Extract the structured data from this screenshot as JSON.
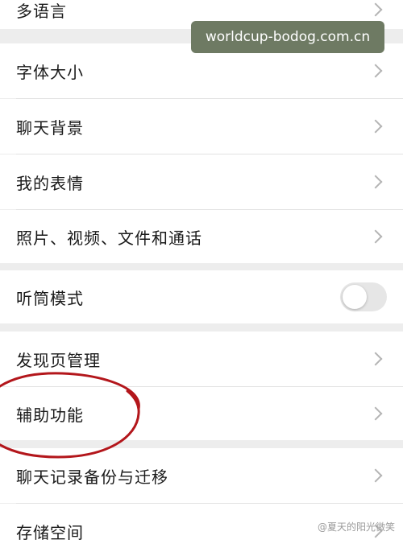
{
  "settings": {
    "rows": [
      {
        "label": "多语言",
        "control": "chevron"
      },
      {
        "label": "字体大小",
        "control": "chevron"
      },
      {
        "label": "聊天背景",
        "control": "chevron"
      },
      {
        "label": "我的表情",
        "control": "chevron"
      },
      {
        "label": "照片、视频、文件和通话",
        "control": "chevron"
      },
      {
        "label": "听筒模式",
        "control": "toggle",
        "toggle_on": false
      },
      {
        "label": "发现页管理",
        "control": "chevron"
      },
      {
        "label": "辅助功能",
        "control": "chevron",
        "highlighted": true
      },
      {
        "label": "聊天记录备份与迁移",
        "control": "chevron"
      },
      {
        "label": "存储空间",
        "control": "chevron"
      }
    ]
  },
  "overlay": {
    "banner_text": "worldcup-bodog.com.cn",
    "footer_watermark": "@夏天的阳光微笑"
  },
  "colors": {
    "background": "#ededed",
    "row_bg": "#ffffff",
    "banner_bg": "#6e7a63",
    "annotation_red": "#b3161b",
    "chevron": "#b4b4b4"
  },
  "icons": {
    "chevron": "chevron-right-icon",
    "toggle": "toggle-switch"
  }
}
